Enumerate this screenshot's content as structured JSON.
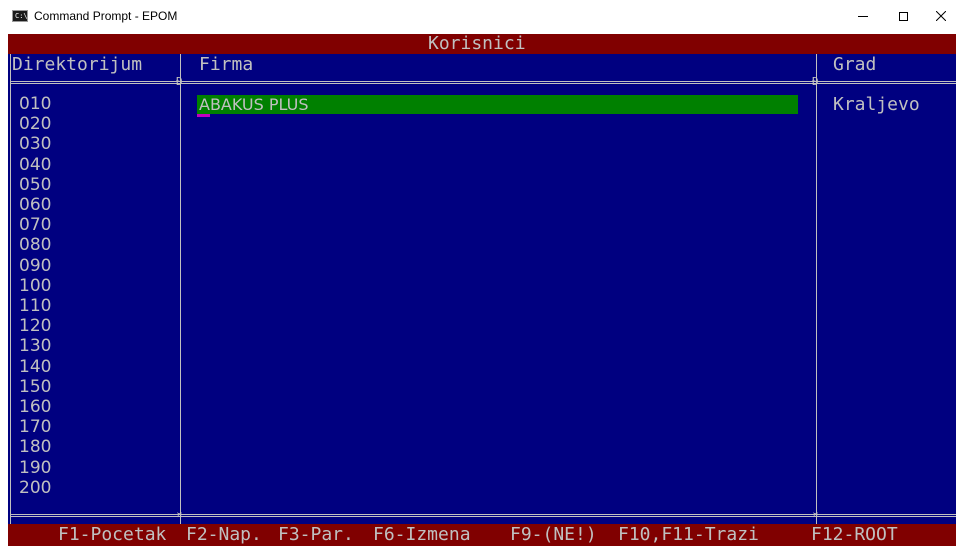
{
  "window": {
    "title": "Command Prompt - EPOM",
    "icon": "console-app-icon",
    "icon_glyph": "C:\\",
    "controls": [
      "minimize-icon",
      "maximize-icon",
      "close-icon"
    ]
  },
  "screen": {
    "title": "Korisnici",
    "columns": {
      "directory": "Direktorijum",
      "firm": "Firma",
      "city": "Grad"
    },
    "directories": [
      "010",
      "020",
      "030",
      "040",
      "050",
      "060",
      "070",
      "080",
      "090",
      "100",
      "110",
      "120",
      "130",
      "140",
      "150",
      "160",
      "170",
      "180",
      "190",
      "200"
    ],
    "selected_row": {
      "firm": "ABAKUS PLUS",
      "city": "Kraljevo"
    },
    "footer_keys": [
      "F1-Pocetak",
      "F2-Nap.",
      "F3-Par.",
      "F6-Izmena",
      "F9-(NE!)",
      "F10,F11-Trazi",
      "F12-ROOT"
    ]
  },
  "colors": {
    "background": "#000080",
    "header_bar": "#800000",
    "selection": "#008000",
    "text": "#c0c0c0",
    "cursor": "#c000c0"
  }
}
